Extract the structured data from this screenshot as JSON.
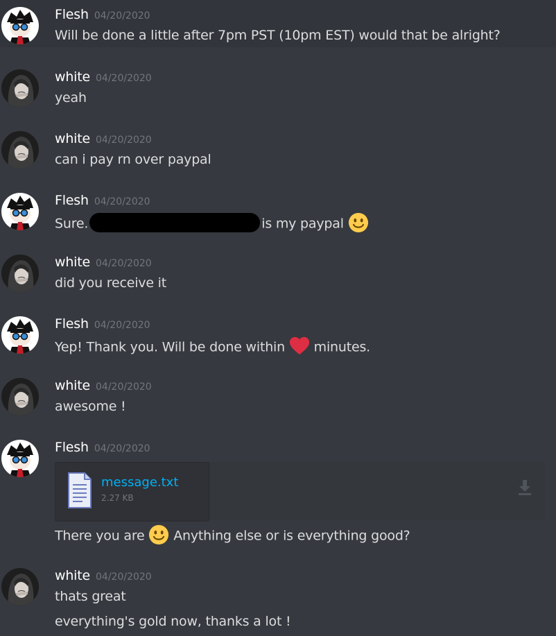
{
  "messages": [
    {
      "user": "Flesh",
      "time": "04/20/2020",
      "lines": [
        "Will be done a little after 7pm PST (10pm EST) would that be alright?"
      ]
    },
    {
      "user": "white",
      "time": "04/20/2020",
      "lines": [
        "yeah"
      ]
    },
    {
      "user": "white",
      "time": "04/20/2020",
      "lines": [
        "can i pay rn over paypal"
      ]
    },
    {
      "user": "Flesh",
      "time": "04/20/2020",
      "before": "Sure.",
      "after": "is my paypal",
      "emoji": "slightly-smiling-face-icon"
    },
    {
      "user": "white",
      "time": "04/20/2020",
      "lines": [
        "did you receive it"
      ]
    },
    {
      "user": "Flesh",
      "time": "04/20/2020",
      "before": "Yep! Thank you. Will be done within",
      "after": "minutes.",
      "emoji": "heart-icon"
    },
    {
      "user": "white",
      "time": "04/20/2020",
      "lines": [
        "awesome !"
      ]
    },
    {
      "user": "Flesh",
      "time": "04/20/2020",
      "attachment": {
        "name": "message.txt",
        "size": "2.27 KB"
      },
      "before": "There you are",
      "after": "Anything else or is everything good?",
      "emoji": "slightly-smiling-face-icon"
    },
    {
      "user": "white",
      "time": "04/20/2020",
      "lines": [
        "thats great",
        "everything's gold now, thanks a lot !"
      ]
    }
  ],
  "colors": {
    "background": "#36393f",
    "username": "#ffffff",
    "timestamp": "#72767d",
    "link": "#00b0f4",
    "text": "#dcddde"
  }
}
